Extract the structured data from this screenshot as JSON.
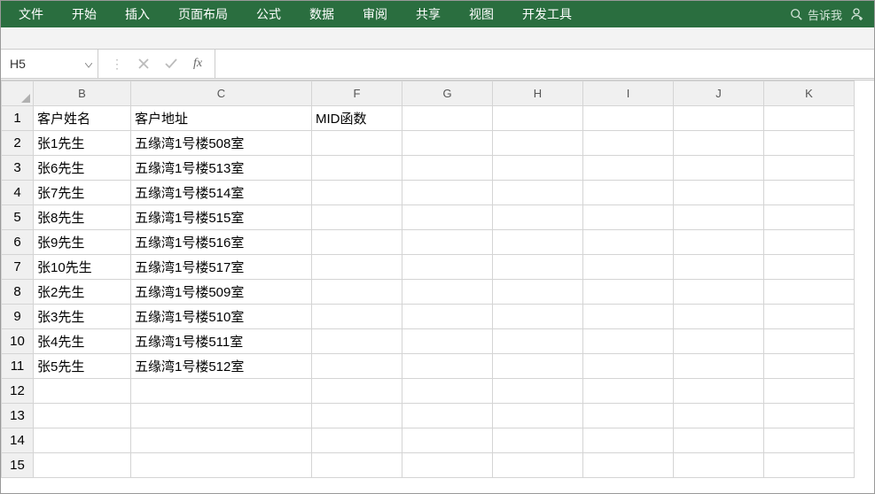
{
  "ribbon": {
    "tabs": [
      "文件",
      "开始",
      "插入",
      "页面布局",
      "公式",
      "数据",
      "审阅",
      "共享",
      "视图",
      "开发工具"
    ],
    "tell_me": "告诉我"
  },
  "formula_bar": {
    "name_box": "H5",
    "fx_label": "fx",
    "formula_value": ""
  },
  "grid": {
    "columns": [
      "B",
      "C",
      "F",
      "G",
      "H",
      "I",
      "J",
      "K"
    ],
    "row_count": 15,
    "cells": {
      "B1": "客户姓名",
      "C1": "客户地址",
      "F1": "MID函数",
      "B2": "张1先生",
      "C2": "五缘湾1号楼508室",
      "B3": "张6先生",
      "C3": "五缘湾1号楼513室",
      "B4": "张7先生",
      "C4": "五缘湾1号楼514室",
      "B5": "张8先生",
      "C5": "五缘湾1号楼515室",
      "B6": "张9先生",
      "C6": "五缘湾1号楼516室",
      "B7": "张10先生",
      "C7": "五缘湾1号楼517室",
      "B8": "张2先生",
      "C8": "五缘湾1号楼509室",
      "B9": "张3先生",
      "C9": "五缘湾1号楼510室",
      "B10": "张4先生",
      "C10": "五缘湾1号楼511室",
      "B11": "张5先生",
      "C11": "五缘湾1号楼512室"
    }
  }
}
